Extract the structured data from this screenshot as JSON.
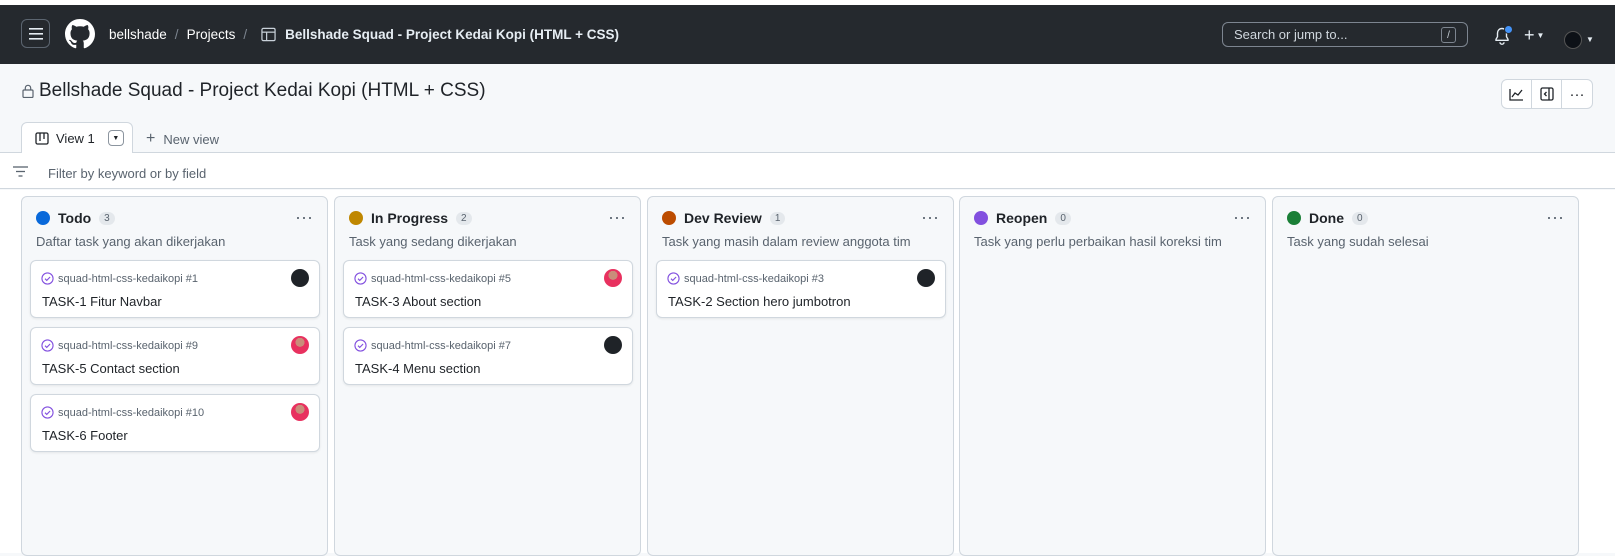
{
  "nav": {
    "owner": "bellshade",
    "projects": "Projects",
    "project": "Bellshade Squad - Project Kedai Kopi (HTML + CSS)",
    "search_placeholder": "Search or jump to...",
    "search_shortcut": "/"
  },
  "header": {
    "title": "Bellshade Squad - Project Kedai Kopi (HTML + CSS)",
    "tab_label": "View 1",
    "new_view_label": "New view",
    "filter_placeholder": "Filter by keyword or by field"
  },
  "columns": [
    {
      "name": "Todo",
      "count": "3",
      "color": "#0969da",
      "description": "Daftar task yang akan dikerjakan",
      "cards": [
        {
          "repo": "squad-html-css-kedaikopi #1",
          "title": "TASK-1 Fitur Navbar",
          "avatar": "dark"
        },
        {
          "repo": "squad-html-css-kedaikopi #9",
          "title": "TASK-5 Contact section",
          "avatar": "pink"
        },
        {
          "repo": "squad-html-css-kedaikopi #10",
          "title": "TASK-6 Footer",
          "avatar": "pink"
        }
      ]
    },
    {
      "name": "In Progress",
      "count": "2",
      "color": "#bf8700",
      "description": "Task yang sedang dikerjakan",
      "cards": [
        {
          "repo": "squad-html-css-kedaikopi #5",
          "title": "TASK-3 About section",
          "avatar": "pink"
        },
        {
          "repo": "squad-html-css-kedaikopi #7",
          "title": "TASK-4 Menu section",
          "avatar": "dark"
        }
      ]
    },
    {
      "name": "Dev Review",
      "count": "1",
      "color": "#bc4c00",
      "description": "Task yang masih dalam review anggota tim",
      "cards": [
        {
          "repo": "squad-html-css-kedaikopi #3",
          "title": "TASK-2 Section hero jumbotron",
          "avatar": "dark"
        }
      ]
    },
    {
      "name": "Reopen",
      "count": "0",
      "color": "#8250df",
      "description": "Task yang perlu perbaikan hasil koreksi tim",
      "cards": []
    },
    {
      "name": "Done",
      "count": "0",
      "color": "#1a7f37",
      "description": "Task yang sudah selesai",
      "cards": []
    }
  ]
}
